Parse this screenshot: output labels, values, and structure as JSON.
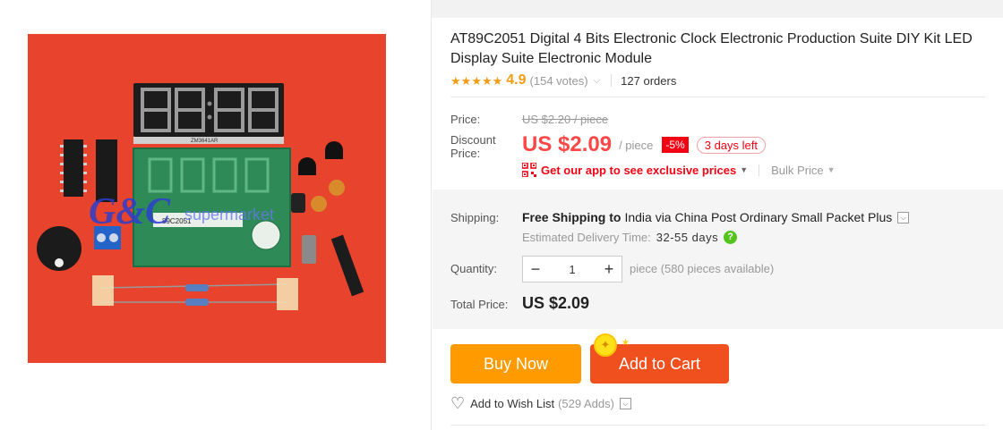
{
  "product": {
    "title": "AT89C2051 Digital 4 Bits Electronic Clock Electronic Production Suite DIY Kit LED Display Suite Electronic Module",
    "image_watermark": "G&C supermarket",
    "image_module_label": "ZM3641AR",
    "image_chip_label": "89C2051",
    "rating": "4.9",
    "rating_stars": 5,
    "votes": "(154 votes)",
    "orders": "127 orders"
  },
  "price": {
    "label": "Price:",
    "original": "US $2.20 / piece",
    "discount_label": "Discount Price:",
    "current": "US $2.09",
    "unit": "/ piece",
    "discount_badge": "-5%",
    "days_left": "3 days left",
    "app_link": "Get our app to see exclusive prices",
    "bulk_price": "Bulk Price"
  },
  "shipping": {
    "label": "Shipping:",
    "free_shipping": "Free Shipping to",
    "destination": "India via China Post Ordinary Small Packet Plus",
    "estimated_label": "Estimated Delivery Time:",
    "estimated_value": "32-55 days"
  },
  "quantity": {
    "label": "Quantity:",
    "value": "1",
    "minus": "−",
    "plus": "+",
    "note": "piece (580 pieces available)"
  },
  "total": {
    "label": "Total Price:",
    "value": "US $2.09"
  },
  "actions": {
    "buy_now": "Buy Now",
    "add_to_cart": "Add to Cart",
    "wish_list": "Add to Wish List",
    "wish_count": "(529 Adds)"
  },
  "colors": {
    "price_red": "#ff4747",
    "buy_orange": "#ff9a00",
    "cart_red": "#f04f1e",
    "star_orange": "#f39c12",
    "image_bg": "#e8432c"
  }
}
